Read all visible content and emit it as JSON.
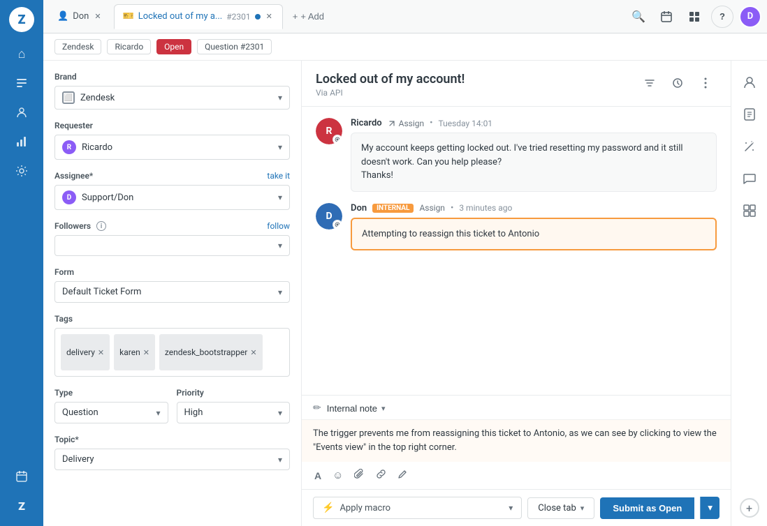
{
  "app": {
    "logo": "Z"
  },
  "sidebar": {
    "icons": [
      {
        "name": "home-icon",
        "symbol": "⌂",
        "active": false
      },
      {
        "name": "tickets-icon",
        "symbol": "☰",
        "active": false
      },
      {
        "name": "customers-icon",
        "symbol": "👤",
        "active": false
      },
      {
        "name": "reporting-icon",
        "symbol": "📊",
        "active": false
      },
      {
        "name": "admin-icon",
        "symbol": "⚙",
        "active": false
      },
      {
        "name": "calendar-icon",
        "symbol": "📅",
        "active": false
      },
      {
        "name": "zendesk-logo-icon",
        "symbol": "Z",
        "active": false
      }
    ]
  },
  "tabs": [
    {
      "id": "don-tab",
      "label": "Don",
      "icon": "person",
      "closeable": true,
      "active": false
    },
    {
      "id": "ticket-tab",
      "label": "Locked out of my a...",
      "number": "#2301",
      "icon": "ticket",
      "closeable": true,
      "active": true,
      "has_dot": true
    }
  ],
  "add_tab": "+ Add",
  "header_actions": {
    "search_icon": "🔍",
    "calendar_icon": "📅",
    "apps_icon": "⊞",
    "help_icon": "?",
    "avatar_label": "D"
  },
  "breadcrumb": {
    "zendesk": "Zendesk",
    "ricardo": "Ricardo",
    "open": "Open",
    "question_number": "Question #2301"
  },
  "left_panel": {
    "brand": {
      "label": "Brand",
      "value": "Zendesk"
    },
    "requester": {
      "label": "Requester",
      "value": "Ricardo"
    },
    "assignee": {
      "label": "Assignee*",
      "action": "take it",
      "value": "Support/Don"
    },
    "followers": {
      "label": "Followers",
      "action": "follow"
    },
    "form": {
      "label": "Form",
      "value": "Default Ticket Form"
    },
    "tags": {
      "label": "Tags",
      "items": [
        {
          "label": "delivery"
        },
        {
          "label": "karen"
        },
        {
          "label": "zendesk_bootstrapper"
        }
      ]
    },
    "type": {
      "label": "Type",
      "value": "Question"
    },
    "priority": {
      "label": "Priority",
      "value": "High"
    },
    "topic": {
      "label": "Topic*",
      "value": "Delivery"
    }
  },
  "ticket": {
    "title": "Locked out of my account!",
    "via": "Via API",
    "messages": [
      {
        "id": "msg-1",
        "author": "Ricardo",
        "avatar_label": "R",
        "avatar_class": "avatar-r",
        "assign_text": "Assign",
        "time": "Tuesday 14:01",
        "internal": false,
        "body": "My account keeps getting locked out. I've tried resetting my password and it still doesn't work. Can you help please?\nThanks!"
      },
      {
        "id": "msg-2",
        "author": "Don",
        "avatar_label": "D",
        "avatar_class": "avatar-d",
        "badge": "internal",
        "assign_text": "Assign",
        "time": "3 minutes ago",
        "internal": true,
        "body": "Attempting to reassign this ticket to Antonio"
      }
    ]
  },
  "compose": {
    "type_label": "Internal note",
    "body": "The trigger prevents me from reassigning this ticket to Antonio, as we can see by clicking to view the \"Events view\" in the top right corner.",
    "tools": {
      "format": "A",
      "emoji": "☺",
      "attach": "📎",
      "link": "🔗",
      "redact": "✏"
    }
  },
  "bottom_bar": {
    "macro_placeholder": "Apply macro",
    "flash_icon": "⚡",
    "close_tab_label": "Close tab",
    "submit_label": "Submit as Open"
  }
}
